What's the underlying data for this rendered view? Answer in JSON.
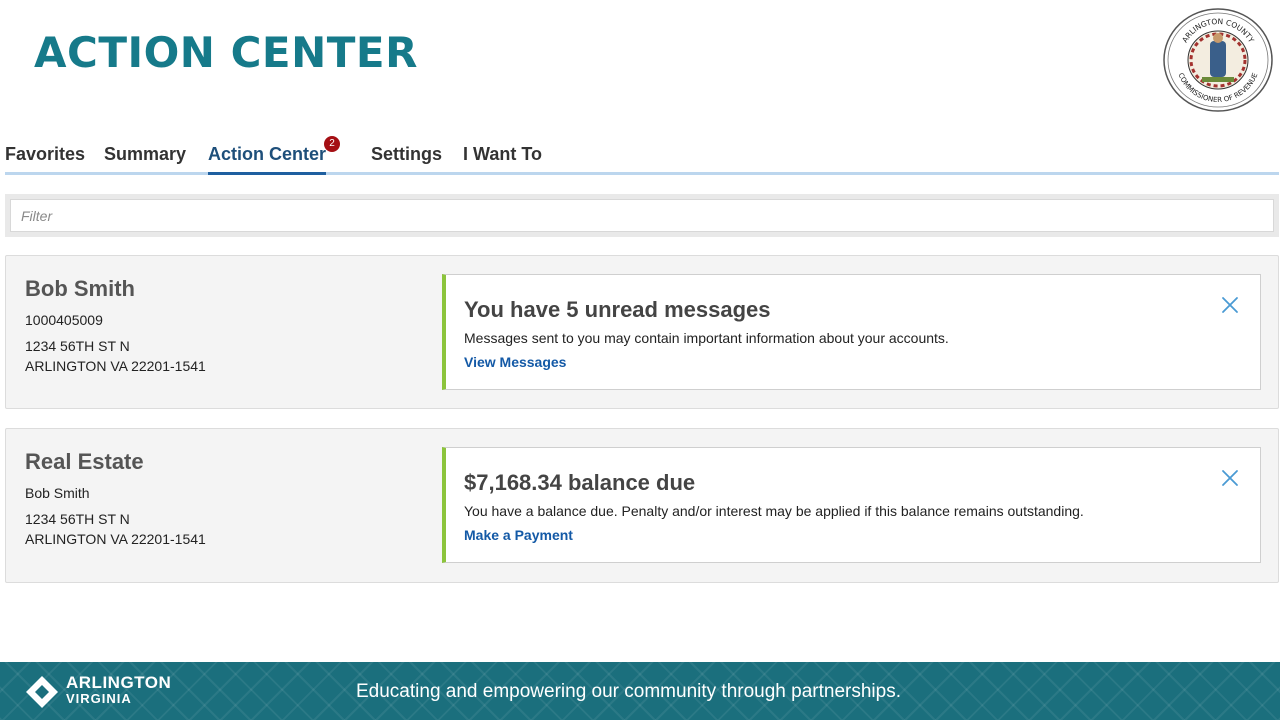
{
  "page": {
    "title": "ACTION CENTER",
    "seal": {
      "text_top": "ARLINGTON COUNTY",
      "text_bottom": "COMMISSIONER OF REVENUE"
    }
  },
  "tabs": [
    {
      "label": "Favorites",
      "active": false
    },
    {
      "label": "Summary",
      "active": false
    },
    {
      "label": "Action Center",
      "active": true,
      "badge": "2"
    },
    {
      "label": "Settings",
      "active": false
    },
    {
      "label": "I Want To",
      "active": false
    }
  ],
  "filter": {
    "placeholder": "Filter",
    "value": ""
  },
  "cards": [
    {
      "heading": "Bob Smith",
      "line1": "1000405009",
      "address1": "1234 56TH ST N",
      "address2": "ARLINGTON VA 22201-1541",
      "notice": {
        "title": "You have 5 unread messages",
        "body": "Messages sent to you may contain important information about your accounts.",
        "link": "View Messages"
      }
    },
    {
      "heading": "Real Estate",
      "line1": "Bob Smith",
      "address1": "1234 56TH ST N",
      "address2": "ARLINGTON VA 22201-1541",
      "notice": {
        "title": "$7,168.34 balance due",
        "body": "You have a balance due. Penalty and/or interest may be applied if this balance remains outstanding.",
        "link": "Make a Payment"
      }
    }
  ],
  "footer": {
    "brand_line1": "ARLINGTON",
    "brand_line2": "VIRGINIA",
    "tagline": "Educating and empowering our community through partnerships."
  },
  "colors": {
    "title": "#167a8a",
    "accent_green": "#8cc43c",
    "link_blue": "#1359a6",
    "footer_teal": "#1b6f7d",
    "badge_red": "#a50f14"
  }
}
